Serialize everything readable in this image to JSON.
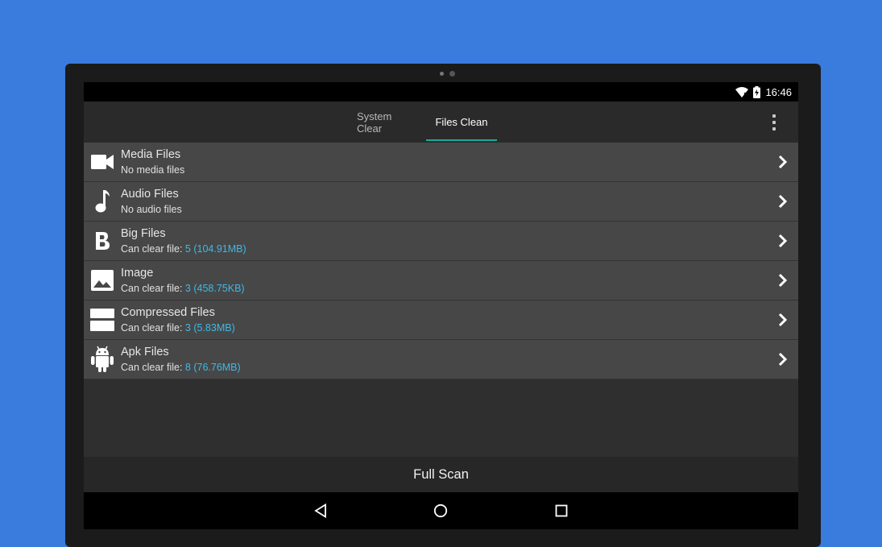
{
  "status_bar": {
    "time": "16:46",
    "icons": [
      "wifi-icon",
      "battery-charging-icon"
    ]
  },
  "tabs": [
    {
      "label": "System Clear",
      "active": false
    },
    {
      "label": "Files Clean",
      "active": true
    }
  ],
  "overflow_menu_icon": "more-vert-icon",
  "file_categories": [
    {
      "title": "Media Files",
      "subtitle_prefix": "No media files",
      "count": "",
      "icon": "video-camera-icon"
    },
    {
      "title": "Audio Files",
      "subtitle_prefix": "No audio files",
      "count": "",
      "icon": "music-note-icon"
    },
    {
      "title": "Big Files",
      "subtitle_prefix": "Can clear file: ",
      "count": "5 (104.91MB)",
      "icon": "big-b-icon"
    },
    {
      "title": "Image",
      "subtitle_prefix": "Can clear file: ",
      "count": "3 (458.75KB)",
      "icon": "image-icon"
    },
    {
      "title": "Compressed Files",
      "subtitle_prefix": "Can clear file: ",
      "count": "3 (5.83MB)",
      "icon": "archive-icon"
    },
    {
      "title": "Apk Files",
      "subtitle_prefix": "Can clear file: ",
      "count": "8 (76.76MB)",
      "icon": "android-icon"
    }
  ],
  "actions": {
    "full_scan_label": "Full Scan"
  },
  "nav_bar": [
    "back-icon",
    "home-icon",
    "recents-icon"
  ],
  "colors": {
    "background": "#3a7bde",
    "accent_tab_underline": "#1fa99a",
    "highlight_count": "#3fb8e8",
    "row_bg": "#474747"
  }
}
